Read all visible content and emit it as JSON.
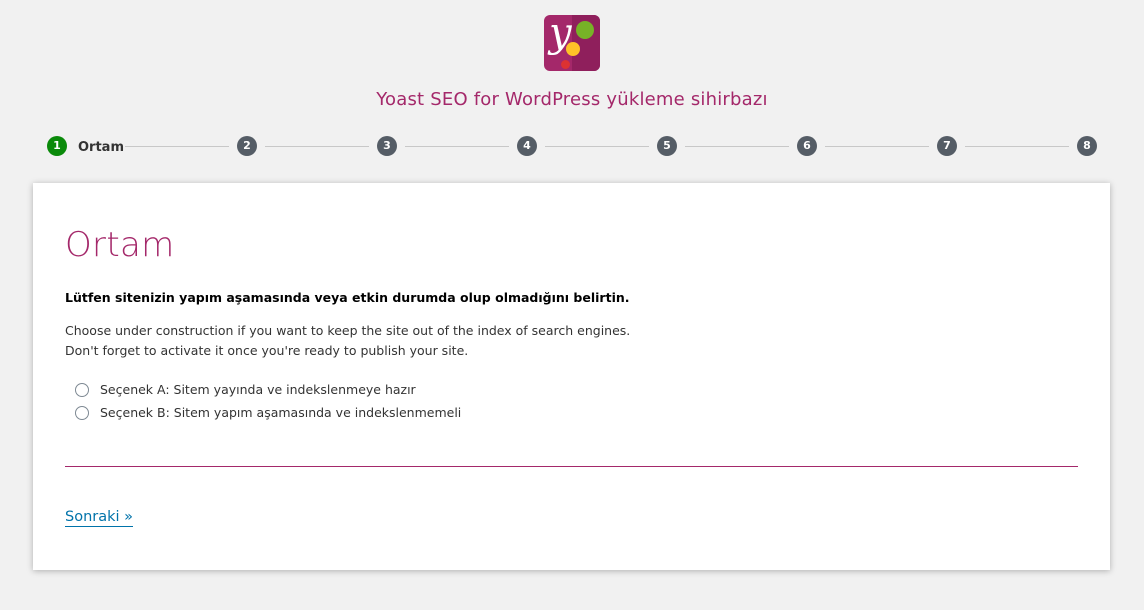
{
  "header": {
    "logo_icon": "yoast-logo-icon",
    "title": "Yoast SEO for WordPress yükleme sihirbazı"
  },
  "stepper": {
    "steps": [
      {
        "number": "1",
        "label": "Ortam",
        "active": true
      },
      {
        "number": "2"
      },
      {
        "number": "3"
      },
      {
        "number": "4"
      },
      {
        "number": "5"
      },
      {
        "number": "6"
      },
      {
        "number": "7"
      },
      {
        "number": "8"
      }
    ]
  },
  "content": {
    "heading": "Ortam",
    "question": "Lütfen sitenizin yapım aşamasında veya etkin durumda olup olmadığını belirtin.",
    "description_line1": "Choose under construction if you want to keep the site out of the index of search engines.",
    "description_line2": "Don't forget to activate it once you're ready to publish your site.",
    "options": [
      {
        "label": "Seçenek A: Sitem yayında ve indekslenmeye hazır",
        "selected": false
      },
      {
        "label": "Seçenek B: Sitem yapım aşamasında ve indekslenmemeli",
        "selected": false
      }
    ],
    "next_label": "Sonraki »"
  },
  "colors": {
    "brand": "#a4286a",
    "active_step": "#0a8a0a",
    "inactive_step": "#555d66",
    "link": "#0073aa"
  }
}
